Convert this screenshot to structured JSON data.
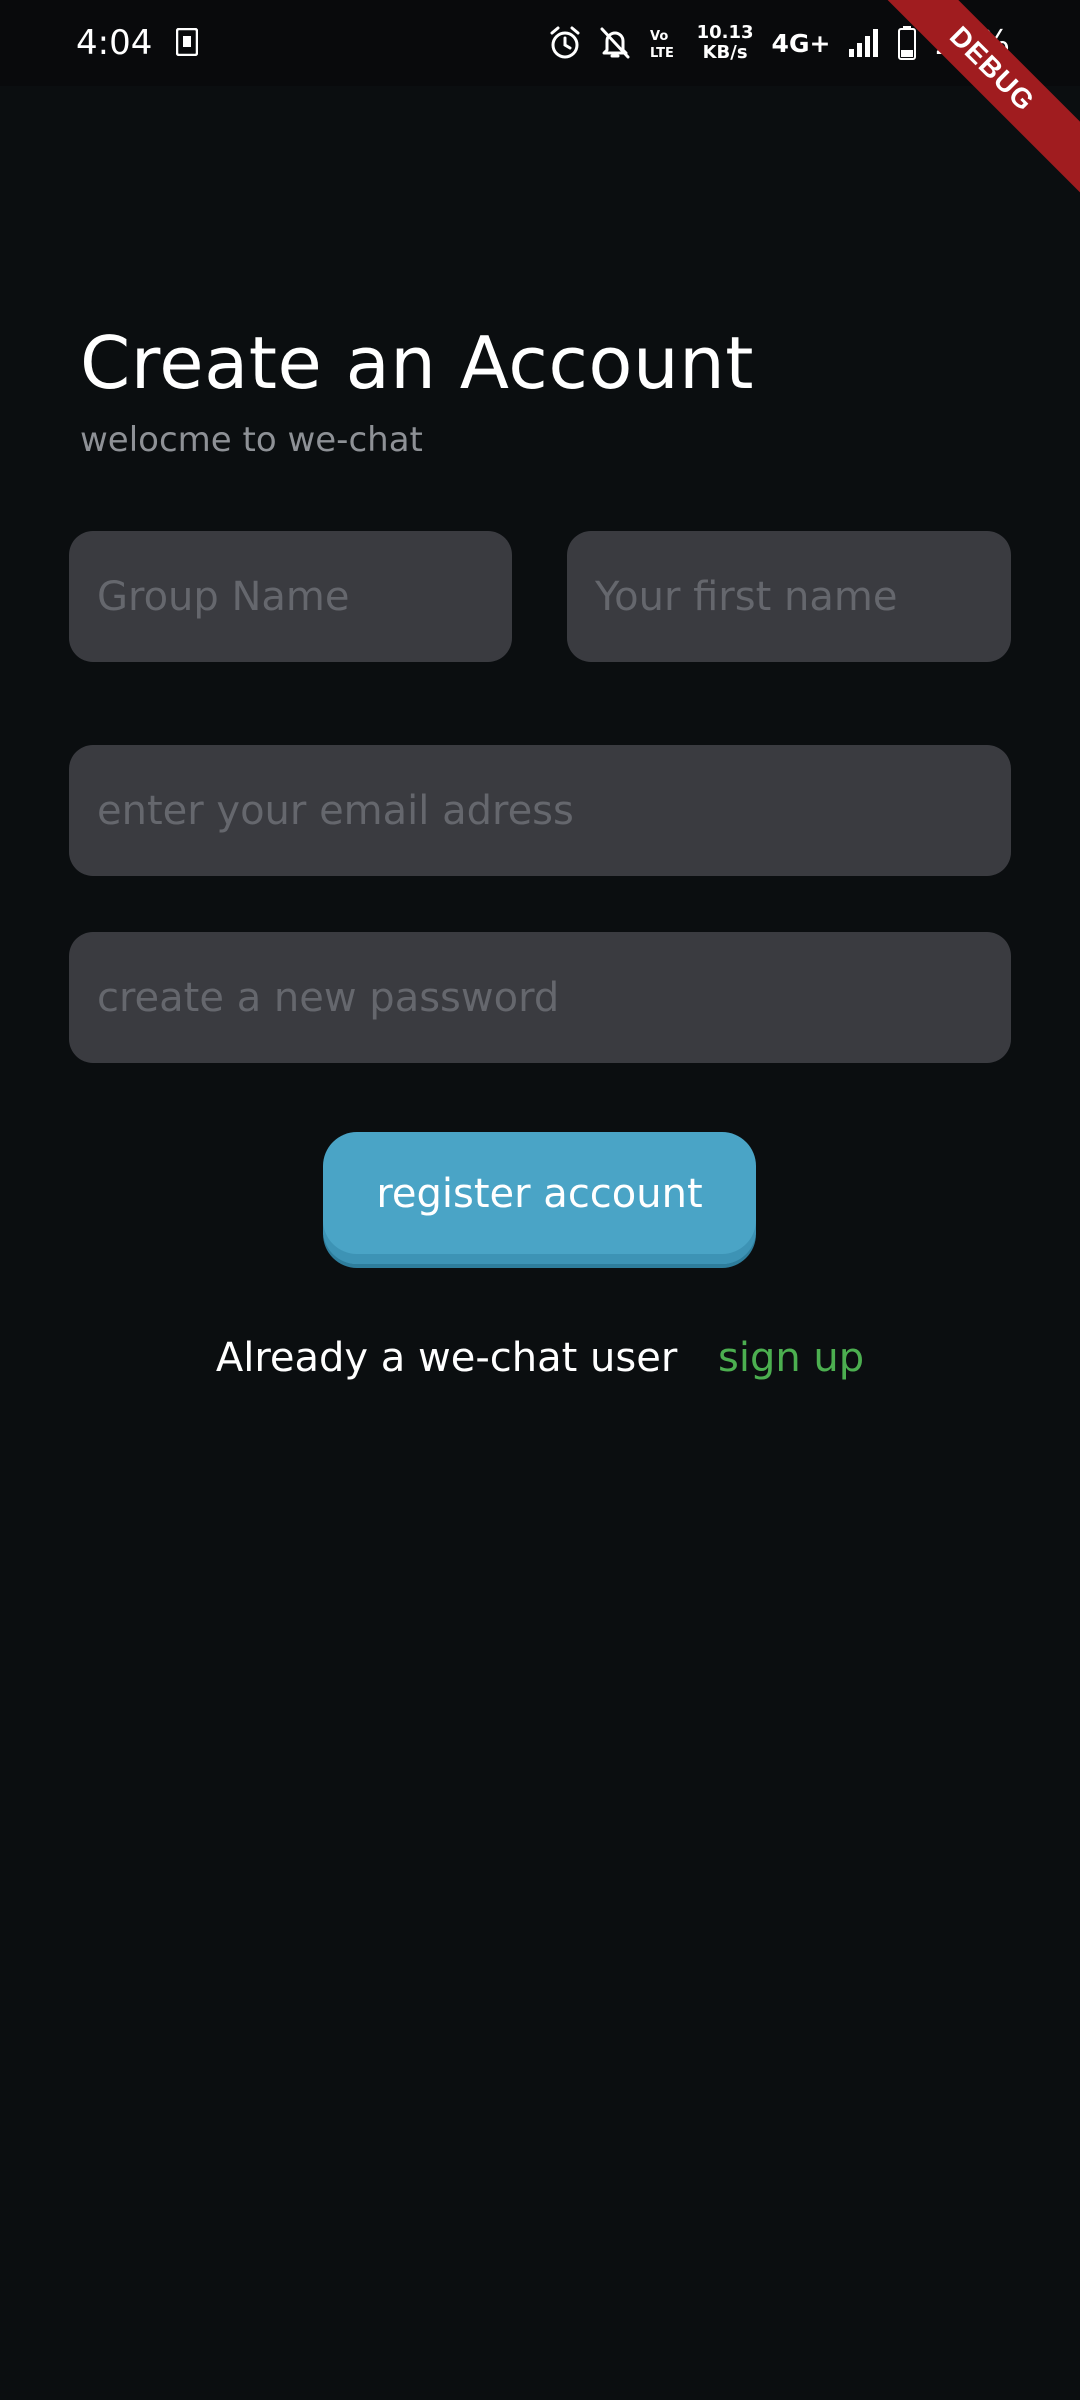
{
  "status_bar": {
    "time": "4:04",
    "net_speed_value": "10.13",
    "net_speed_unit": "KB/s",
    "network_type": "4G+",
    "battery_percent": "27%",
    "icons": [
      "sim-card-icon",
      "alarm-icon",
      "bell-muted-icon",
      "volte-icon",
      "signal-icon",
      "battery-icon"
    ]
  },
  "debug_banner": "DEBUG",
  "header": {
    "title": "Create an Account",
    "subtitle": "welocme to we-chat"
  },
  "form": {
    "group_name_placeholder": "Group Name",
    "first_name_placeholder": "Your first name",
    "email_placeholder": "enter your email adress",
    "password_placeholder": "create a new password",
    "register_label": "register account"
  },
  "footer": {
    "already_text": "Already a we-chat user",
    "signup_label": "sign up"
  },
  "colors": {
    "background": "#0b0e10",
    "field": "#3a3b40",
    "button": "#4aa4c6",
    "link": "#4caf50",
    "debug": "#a01c1f"
  }
}
